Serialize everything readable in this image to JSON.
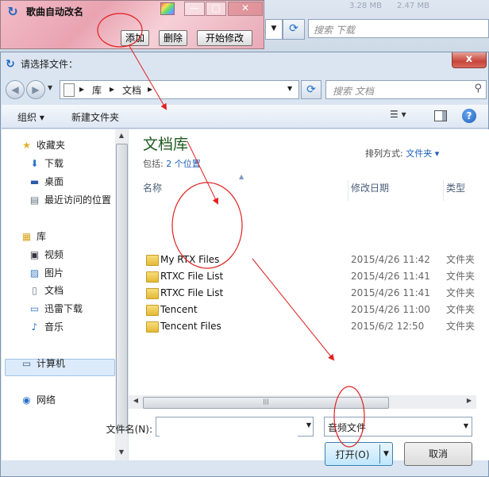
{
  "background_window": {
    "search_placeholder": "搜索 下载",
    "col_a": "3.28 MB",
    "col_b": "2.47 MB"
  },
  "app": {
    "title": "歌曲自动改名",
    "buttons": {
      "add": "添加",
      "delete": "删除",
      "start": "开始修改"
    }
  },
  "dialog": {
    "title": "请选择文件：",
    "close_glyph": "x",
    "breadcrumb": [
      "库",
      "文档"
    ],
    "search_placeholder": "搜索 文档",
    "toolbar": {
      "organize": "组织 ▾",
      "new_folder": "新建文件夹"
    },
    "nav": {
      "favorites_header": "收藏夹",
      "favorites": [
        "下载",
        "桌面",
        "最近访问的位置"
      ],
      "libraries_header": "库",
      "libraries": [
        "视频",
        "图片",
        "文档",
        "迅雷下载",
        "音乐"
      ],
      "computer": "计算机",
      "network": "网络"
    },
    "library": {
      "title": "文档库",
      "includes_label": "包括:",
      "locations_link": "2 个位置",
      "arrange_label": "排列方式:",
      "arrange_value": "文件夹 ▾"
    },
    "columns": {
      "name": "名称",
      "date": "修改日期",
      "type": "类型"
    },
    "files": [
      {
        "name": "My RTX Files",
        "date": "2015/4/26 11:42",
        "type": "文件夹"
      },
      {
        "name": "RTXC File List",
        "date": "2015/4/26 11:41",
        "type": "文件夹"
      },
      {
        "name": "RTXC File List",
        "date": "2015/4/26 11:41",
        "type": "文件夹"
      },
      {
        "name": "Tencent",
        "date": "2015/4/26 11:00",
        "type": "文件夹"
      },
      {
        "name": "Tencent Files",
        "date": "2015/6/2 12:50",
        "type": "文件夹"
      }
    ],
    "filename_label": "文件名(N):",
    "filename_value": "",
    "filter_value": "音频文件",
    "open_button": "打开(O)",
    "cancel_button": "取消"
  },
  "colors": {
    "annotation_red": "#e02020",
    "library_title": "#1e5a1e",
    "link": "#1c5fb8"
  }
}
